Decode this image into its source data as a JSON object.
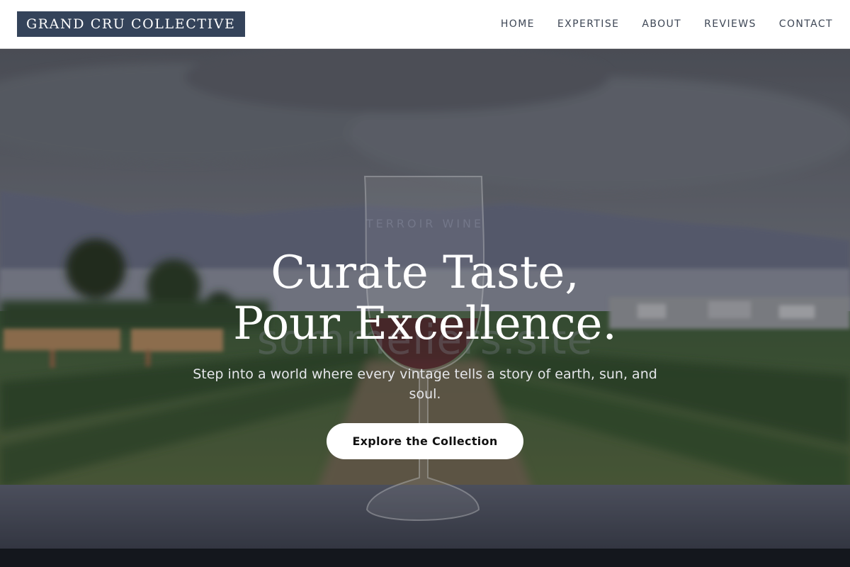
{
  "header": {
    "logo": "GRAND CRU COLLECTIVE",
    "nav": [
      "HOME",
      "EXPERTISE",
      "ABOUT",
      "REVIEWS",
      "CONTACT"
    ]
  },
  "hero": {
    "eyebrow": "TERROIR WINE",
    "watermark": "sommeliers.site",
    "title": "Curate Taste, Pour Excellence.",
    "subtitle": "Step into a world where every vintage tells a story of earth, sun, and soul.",
    "cta_label": "Explore the Collection",
    "background": "vineyard-with-wine-glass-photo"
  },
  "colors": {
    "logo_bg": "#34435a",
    "nav_text": "#3d4655",
    "cta_bg": "#ffffff",
    "title_text": "#ffffff"
  }
}
